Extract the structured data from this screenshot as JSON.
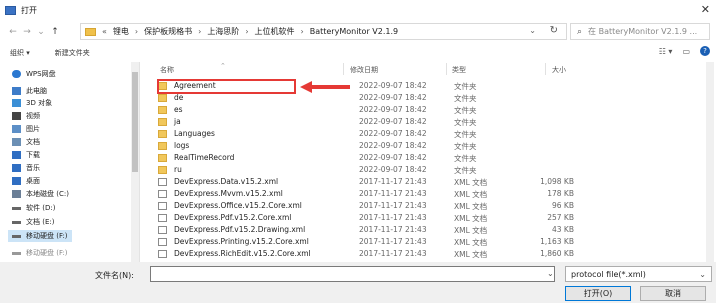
{
  "window": {
    "title": "打开"
  },
  "address": {
    "crumbs": [
      "锂电",
      "保护板规格书",
      "上海思阶",
      "上位机软件",
      "BatteryMonitor V2.1.9"
    ],
    "leading": "«"
  },
  "search": {
    "placeholder": "在 BatteryMonitor V2.1.9 ..."
  },
  "toolbar": {
    "organize": "组织 ▾",
    "new_folder": "新建文件夹"
  },
  "sidebar": {
    "items": [
      {
        "label": "WPS网盘",
        "color": "#2b78d0"
      },
      {
        "label": "此电脑",
        "color": "#3d7cc9"
      },
      {
        "label": "3D 对象",
        "color": "#3b8fd6"
      },
      {
        "label": "视频",
        "color": "#444"
      },
      {
        "label": "图片",
        "color": "#5c8fc7"
      },
      {
        "label": "文档",
        "color": "#6b8fb4"
      },
      {
        "label": "下载",
        "color": "#2f6ec2"
      },
      {
        "label": "音乐",
        "color": "#2f6ec2"
      },
      {
        "label": "桌面",
        "color": "#2f6ec2"
      },
      {
        "label": "本地磁盘 (C:)",
        "color": "#6b7f97"
      },
      {
        "label": "软件 (D:)",
        "color": "#666"
      },
      {
        "label": "文档 (E:)",
        "color": "#666"
      },
      {
        "label": "移动硬盘 (F:)",
        "color": "#666"
      },
      {
        "label": "移动硬盘 (F:)",
        "color": "#666"
      }
    ]
  },
  "columns": {
    "name": "名称",
    "date": "修改日期",
    "type": "类型",
    "size": "大小"
  },
  "files": [
    {
      "name": "Agreement",
      "date": "2022-09-07 18:42",
      "type": "文件夹",
      "size": "",
      "kind": "folder"
    },
    {
      "name": "de",
      "date": "2022-09-07 18:42",
      "type": "文件夹",
      "size": "",
      "kind": "folder"
    },
    {
      "name": "es",
      "date": "2022-09-07 18:42",
      "type": "文件夹",
      "size": "",
      "kind": "folder"
    },
    {
      "name": "ja",
      "date": "2022-09-07 18:42",
      "type": "文件夹",
      "size": "",
      "kind": "folder"
    },
    {
      "name": "Languages",
      "date": "2022-09-07 18:42",
      "type": "文件夹",
      "size": "",
      "kind": "folder"
    },
    {
      "name": "logs",
      "date": "2022-09-07 18:42",
      "type": "文件夹",
      "size": "",
      "kind": "folder"
    },
    {
      "name": "RealTimeRecord",
      "date": "2022-09-07 18:42",
      "type": "文件夹",
      "size": "",
      "kind": "folder"
    },
    {
      "name": "ru",
      "date": "2022-09-07 18:42",
      "type": "文件夹",
      "size": "",
      "kind": "folder"
    },
    {
      "name": "DevExpress.Data.v15.2.xml",
      "date": "2017-11-17 21:43",
      "type": "XML 文档",
      "size": "1,098 KB",
      "kind": "file"
    },
    {
      "name": "DevExpress.Mvvm.v15.2.xml",
      "date": "2017-11-17 21:43",
      "type": "XML 文档",
      "size": "178 KB",
      "kind": "file"
    },
    {
      "name": "DevExpress.Office.v15.2.Core.xml",
      "date": "2017-11-17 21:43",
      "type": "XML 文档",
      "size": "96 KB",
      "kind": "file"
    },
    {
      "name": "DevExpress.Pdf.v15.2.Core.xml",
      "date": "2017-11-17 21:43",
      "type": "XML 文档",
      "size": "257 KB",
      "kind": "file"
    },
    {
      "name": "DevExpress.Pdf.v15.2.Drawing.xml",
      "date": "2017-11-17 21:43",
      "type": "XML 文档",
      "size": "43 KB",
      "kind": "file"
    },
    {
      "name": "DevExpress.Printing.v15.2.Core.xml",
      "date": "2017-11-17 21:43",
      "type": "XML 文档",
      "size": "1,163 KB",
      "kind": "file"
    },
    {
      "name": "DevExpress.RichEdit.v15.2.Core.xml",
      "date": "2017-11-17 21:43",
      "type": "XML 文档",
      "size": "1,860 KB",
      "kind": "file"
    }
  ],
  "bottom": {
    "filename_label": "文件名(N):",
    "filetype": "protocol file(*.xml)",
    "open": "打开(O)",
    "cancel": "取消"
  },
  "colors": {
    "highlight": "#e53935",
    "arrow": "#e53935",
    "folder": "#f1c75b"
  }
}
